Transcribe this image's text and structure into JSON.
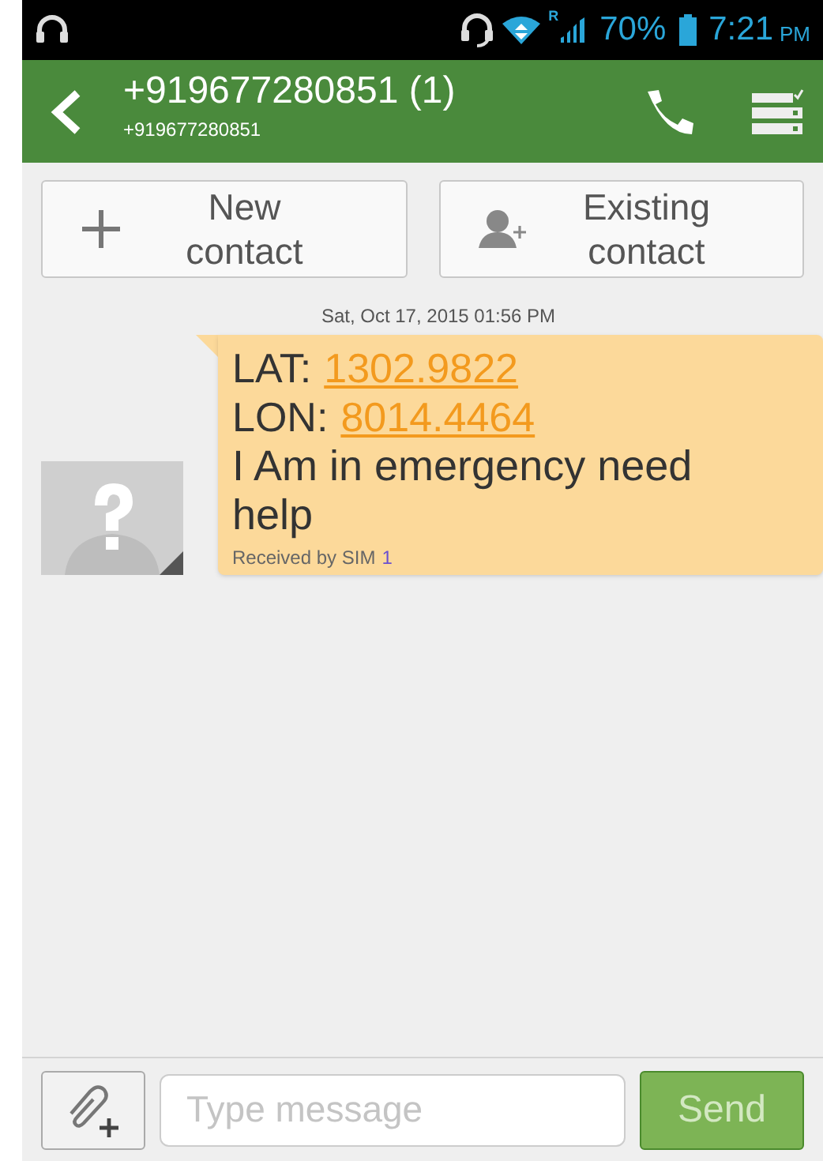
{
  "status_bar": {
    "battery": "70%",
    "time": "7:21",
    "meridiem": "PM",
    "roaming": "R"
  },
  "header": {
    "title": "+919677280851 (1)",
    "subtitle": "+919677280851"
  },
  "contact_actions": [
    {
      "label_lines": [
        "New",
        "contact"
      ],
      "kind": "new"
    },
    {
      "label_lines": [
        "Existing",
        "contact"
      ],
      "kind": "existing"
    }
  ],
  "message": {
    "timestamp": "Sat, Oct 17, 2015 01:56 PM",
    "coordinates": [
      {
        "label": "LAT:",
        "value": "1302.9822"
      },
      {
        "label": "LON:",
        "value": "8014.4464"
      }
    ],
    "text": "I Am in emergency need help",
    "received_by": "Received by SIM",
    "sim": "1"
  },
  "composer": {
    "placeholder": "Type message",
    "send": {
      "label": "Send",
      "disabled": true
    }
  }
}
